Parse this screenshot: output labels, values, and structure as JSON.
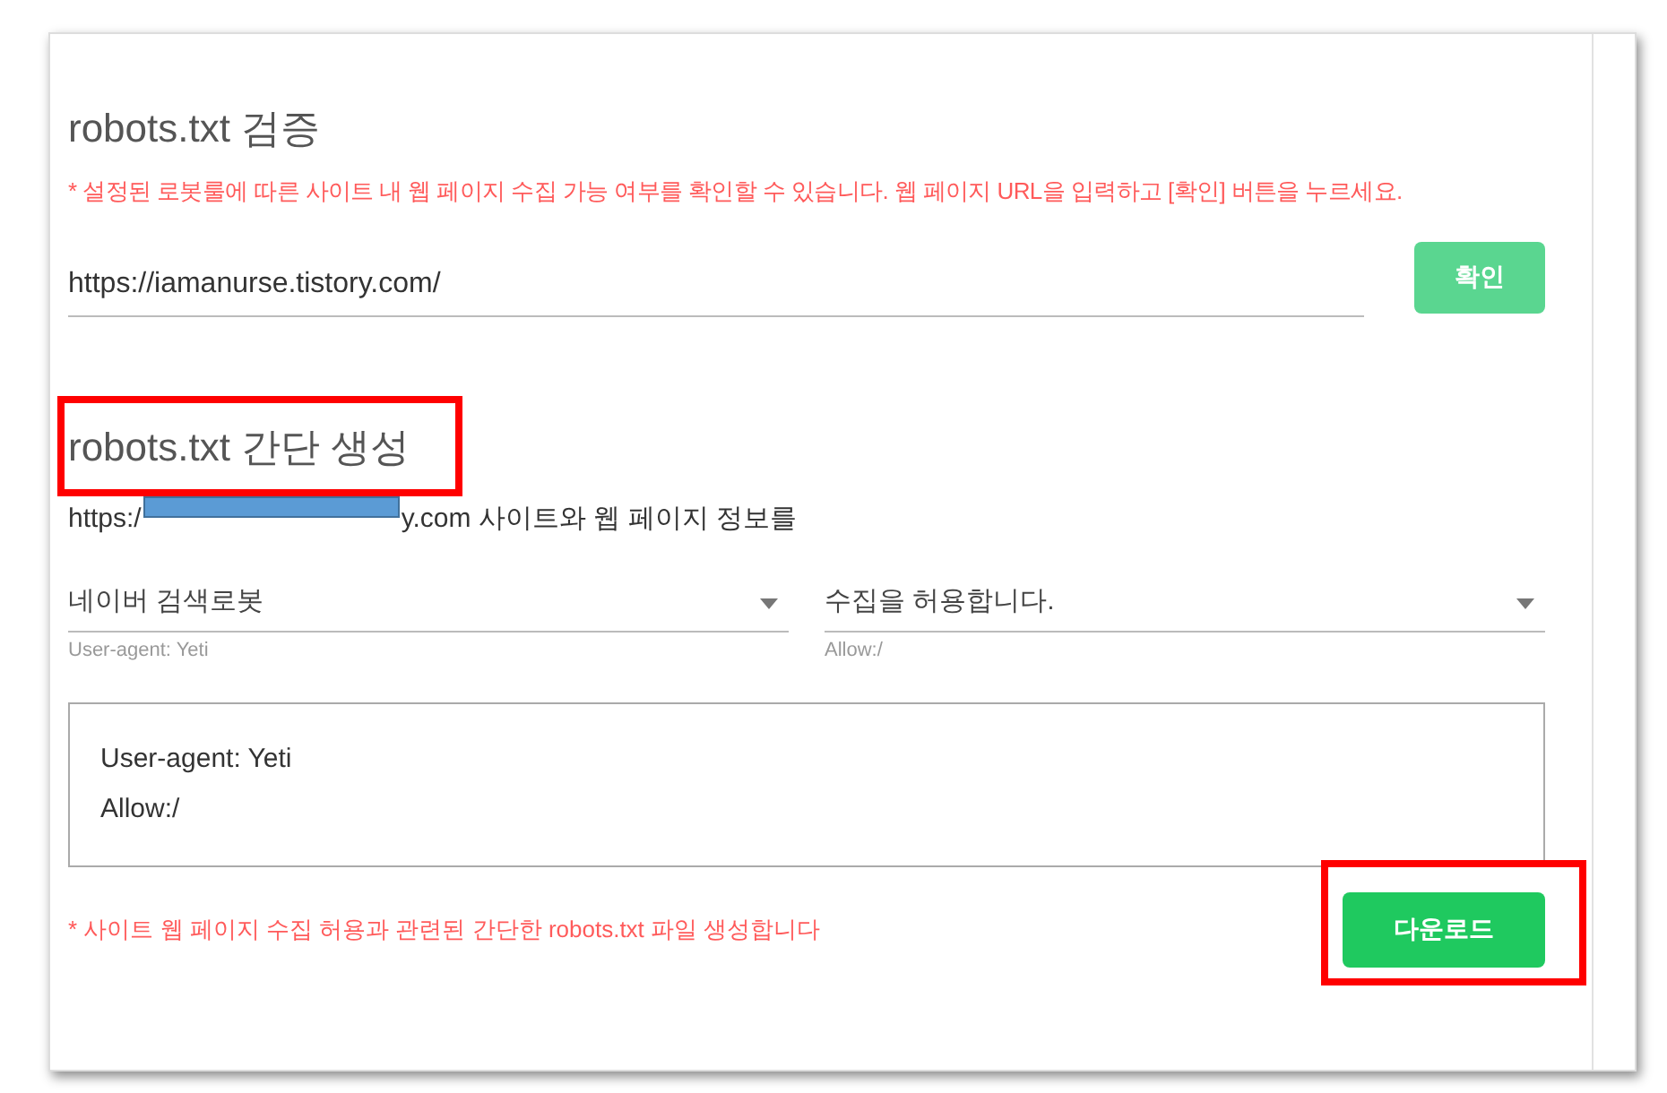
{
  "verify": {
    "title": "robots.txt 검증",
    "notice": "* 설정된 로봇룰에 따른 사이트 내 웹 페이지 수집 가능 여부를 확인할 수 있습니다. 웹 페이지 URL을 입력하고 [확인] 버튼을 누르세요.",
    "url_value": "https://iamanurse.tistory.com/",
    "button": "확인"
  },
  "generate": {
    "title": "robots.txt 간단 생성",
    "title_highlighted": true,
    "info_before": "https:/",
    "info_after": "y.com 사이트와 웹 페이지 정보를",
    "selects": [
      {
        "value": "네이버 검색로봇",
        "hint": "User-agent: Yeti"
      },
      {
        "value": "수집을 허용합니다.",
        "hint": "Allow:/"
      }
    ],
    "output_lines": [
      "User-agent: Yeti",
      "Allow:/"
    ],
    "notice": "* 사이트 웹 페이지 수집 허용과 관련된 간단한 robots.txt 파일 생성합니다",
    "button": "다운로드",
    "button_highlighted": true
  }
}
